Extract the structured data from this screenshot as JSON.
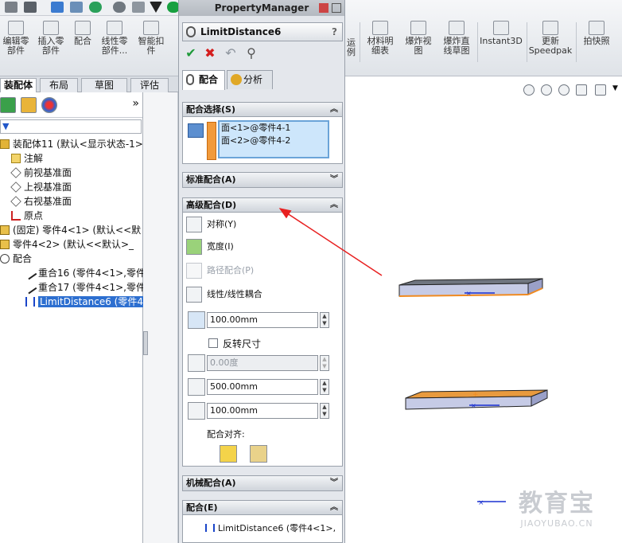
{
  "toolbar": {
    "ribbon": [
      {
        "label": "编辑零\n部件"
      },
      {
        "label": "插入零\n部件"
      },
      {
        "label": "配合"
      },
      {
        "label": "线性零\n部件..."
      },
      {
        "label": "智能扣\n件"
      },
      {
        "label": "运\n例"
      },
      {
        "label": "材料明\n细表"
      },
      {
        "label": "爆炸视\n图"
      },
      {
        "label": "爆炸直\n线草图"
      },
      {
        "label": "Instant3D"
      },
      {
        "label": "更新\nSpeedpak"
      },
      {
        "label": "拍快照"
      }
    ]
  },
  "left_tabs": [
    "装配体",
    "布局",
    "草图",
    "评估"
  ],
  "tree": {
    "items": [
      {
        "label": "装配体11  (默认<显示状态-1>"
      },
      {
        "label": "注解"
      },
      {
        "label": "前视基准面"
      },
      {
        "label": "上视基准面"
      },
      {
        "label": "右视基准面"
      },
      {
        "label": "原点"
      },
      {
        "label": "(固定) 零件4<1> (默认<<默"
      },
      {
        "label": "零件4<2> (默认<<默认>_"
      },
      {
        "label": "配合"
      },
      {
        "label": "重合16 (零件4<1>,零件"
      },
      {
        "label": "重合17 (零件4<1>,零件"
      },
      {
        "label": "LimitDistance6 (零件4<"
      }
    ],
    "expand_more": "»"
  },
  "pm": {
    "title": "PropertyManager",
    "feature_name": "LimitDistance6",
    "help": "?",
    "tabs": [
      "配合",
      "分析"
    ],
    "sections": {
      "selection": {
        "title": "配合选择(S)",
        "faces": [
          "面<1>@零件4-1",
          "面<2>@零件4-2"
        ]
      },
      "standard": {
        "title": "标准配合(A)"
      },
      "advanced": {
        "title": "高级配合(D)",
        "options": [
          "对称(Y)",
          "宽度(I)",
          "路径配合(P)",
          "线性/线性耦合"
        ],
        "distance": "100.00mm",
        "flip": "反转尺寸",
        "angle": "0.00度",
        "max": "500.00mm",
        "min": "100.00mm",
        "align_label": "配合对齐:"
      },
      "mechanical": {
        "title": "机械配合(A)"
      },
      "mates": {
        "title": "配合(E)",
        "item": "LimitDistance6 (零件4<1>,"
      }
    }
  },
  "watermark": {
    "big": "教育宝",
    "small": "JIAOYUBAO.CN"
  }
}
